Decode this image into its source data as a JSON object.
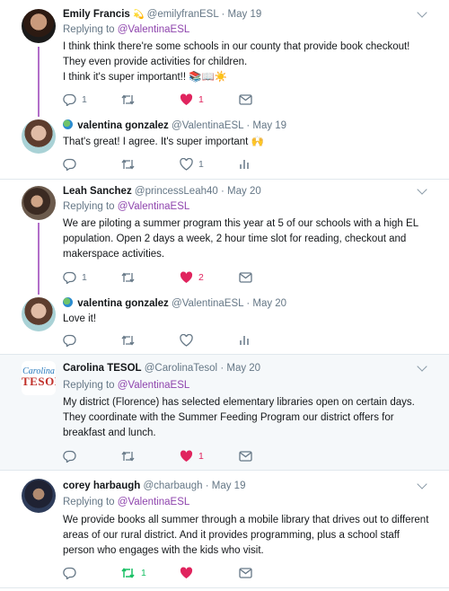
{
  "tweets": [
    {
      "name": "Emily Francis",
      "emoji": "💫",
      "handle": "@emilyfranESL",
      "time": "May 19",
      "replying_label": "Replying to",
      "replying_to": "@ValentinaESL",
      "lines": [
        "I think think there're some schools in our county that provide book checkout!",
        "They even provide activities for children.",
        "I think it's super important!! 📚📖☀️"
      ],
      "replies": "1",
      "retweets": "",
      "likes": "1",
      "liked": true,
      "tail_icon": "mail-icon"
    },
    {
      "name": "valentina gonzalez",
      "handle": "@ValentinaESL",
      "time": "May 19",
      "lines": [
        "That's great! I agree. It's super important 🙌"
      ],
      "replies": "",
      "retweets": "",
      "likes": "1",
      "liked": false,
      "tail_icon": "analytics-icon"
    },
    {
      "name": "Leah Sanchez",
      "handle": "@princessLeah40",
      "time": "May 20",
      "replying_label": "Replying to",
      "replying_to": "@ValentinaESL",
      "lines": [
        "We are piloting a summer program this year at 5 of our schools with a high EL",
        "population. Open 2 days a week, 2 hour time slot for reading, checkout and",
        "makerspace activities."
      ],
      "replies": "1",
      "retweets": "",
      "likes": "2",
      "liked": true,
      "tail_icon": "mail-icon"
    },
    {
      "name": "valentina gonzalez",
      "handle": "@ValentinaESL",
      "time": "May 20",
      "lines": [
        "Love it!"
      ],
      "replies": "",
      "retweets": "",
      "likes": "",
      "liked": false,
      "tail_icon": "analytics-icon"
    },
    {
      "name": "Carolina TESOL",
      "handle": "@CarolinaTesol",
      "time": "May 20",
      "logo_top": "Carolina",
      "logo_bottom": "TESOL",
      "replying_label": "Replying to",
      "replying_to": "@ValentinaESL",
      "lines": [
        "My district (Florence) has selected elementary libraries open on certain days.",
        "They coordinate with the Summer Feeding Program our district offers for",
        "breakfast and lunch."
      ],
      "replies": "",
      "retweets": "",
      "likes": "1",
      "liked": true,
      "tail_icon": "mail-icon"
    },
    {
      "name": "corey harbaugh",
      "handle": "@charbaugh",
      "time": "May 19",
      "replying_label": "Replying to",
      "replying_to": "@ValentinaESL",
      "lines": [
        "We provide books all summer through a mobile library that drives out to different",
        "areas of our rural district. And it provides programming, plus a school staff",
        "person who engages with the kids who visit."
      ],
      "replies": "",
      "retweets": "1",
      "retweeted": true,
      "likes": "",
      "liked": true,
      "tail_icon": "mail-icon"
    }
  ],
  "separator_char": "·",
  "colors": {
    "like_red": "#e0245e",
    "retweet_green": "#17bf63",
    "mention_purple": "#8e44ad",
    "thread_line": "#b26ec9",
    "muted": "#657786"
  }
}
